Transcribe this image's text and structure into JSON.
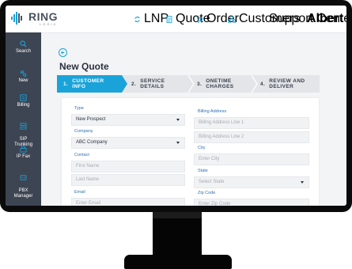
{
  "brand": {
    "name": "RING",
    "sub": "LOGIX"
  },
  "nav": {
    "lnp": "LNP",
    "quote": "Quote",
    "order": "Order",
    "customers": "Customers",
    "support": "Support Center",
    "user": "Albert Diaz"
  },
  "sidebar": {
    "items": [
      {
        "label": "Search",
        "icon": "search-icon"
      },
      {
        "label": "New",
        "icon": "new-icon"
      },
      {
        "label": "Billing",
        "icon": "billing-icon"
      },
      {
        "label": "SIP\nTrunking",
        "icon": "sip-trunking-icon"
      },
      {
        "label": "IP Fax",
        "icon": "fax-icon"
      },
      {
        "label": "PBX\nManager",
        "icon": "pbx-icon"
      }
    ]
  },
  "page": {
    "title": "New Quote"
  },
  "steps": [
    {
      "num": "1.",
      "label": "CUSTOMER\nINFO"
    },
    {
      "num": "2.",
      "label": "SERVICE\nDETAILS"
    },
    {
      "num": "3.",
      "label": "ONETIME\nCHARGES"
    },
    {
      "num": "4.",
      "label": "REVIEW AND\nDELIVER"
    }
  ],
  "colors": {
    "accent": "#1aa3d9",
    "sidebar": "#3d4452",
    "step_inactive": "#e3e5e8",
    "label": "#2f6fb0"
  },
  "form": {
    "type": {
      "label": "Type",
      "value": "New Prospect"
    },
    "company": {
      "label": "Company",
      "value": "ABC Company"
    },
    "contact": {
      "label": "Contact",
      "first_name_placeholder": "First Name",
      "last_name_placeholder": "Last Name"
    },
    "email": {
      "label": "Email",
      "placeholder": "Enter Email"
    },
    "billing": {
      "label": "Billing Address",
      "line1_placeholder": "Billing Address Line 1",
      "line2_placeholder": "Billing Address Line 2"
    },
    "city": {
      "label": "City",
      "placeholder": "Enter City"
    },
    "state": {
      "label": "State",
      "placeholder": "Select State"
    },
    "zip": {
      "label": "Zip Code",
      "placeholder": "Enter Zip Code"
    }
  }
}
